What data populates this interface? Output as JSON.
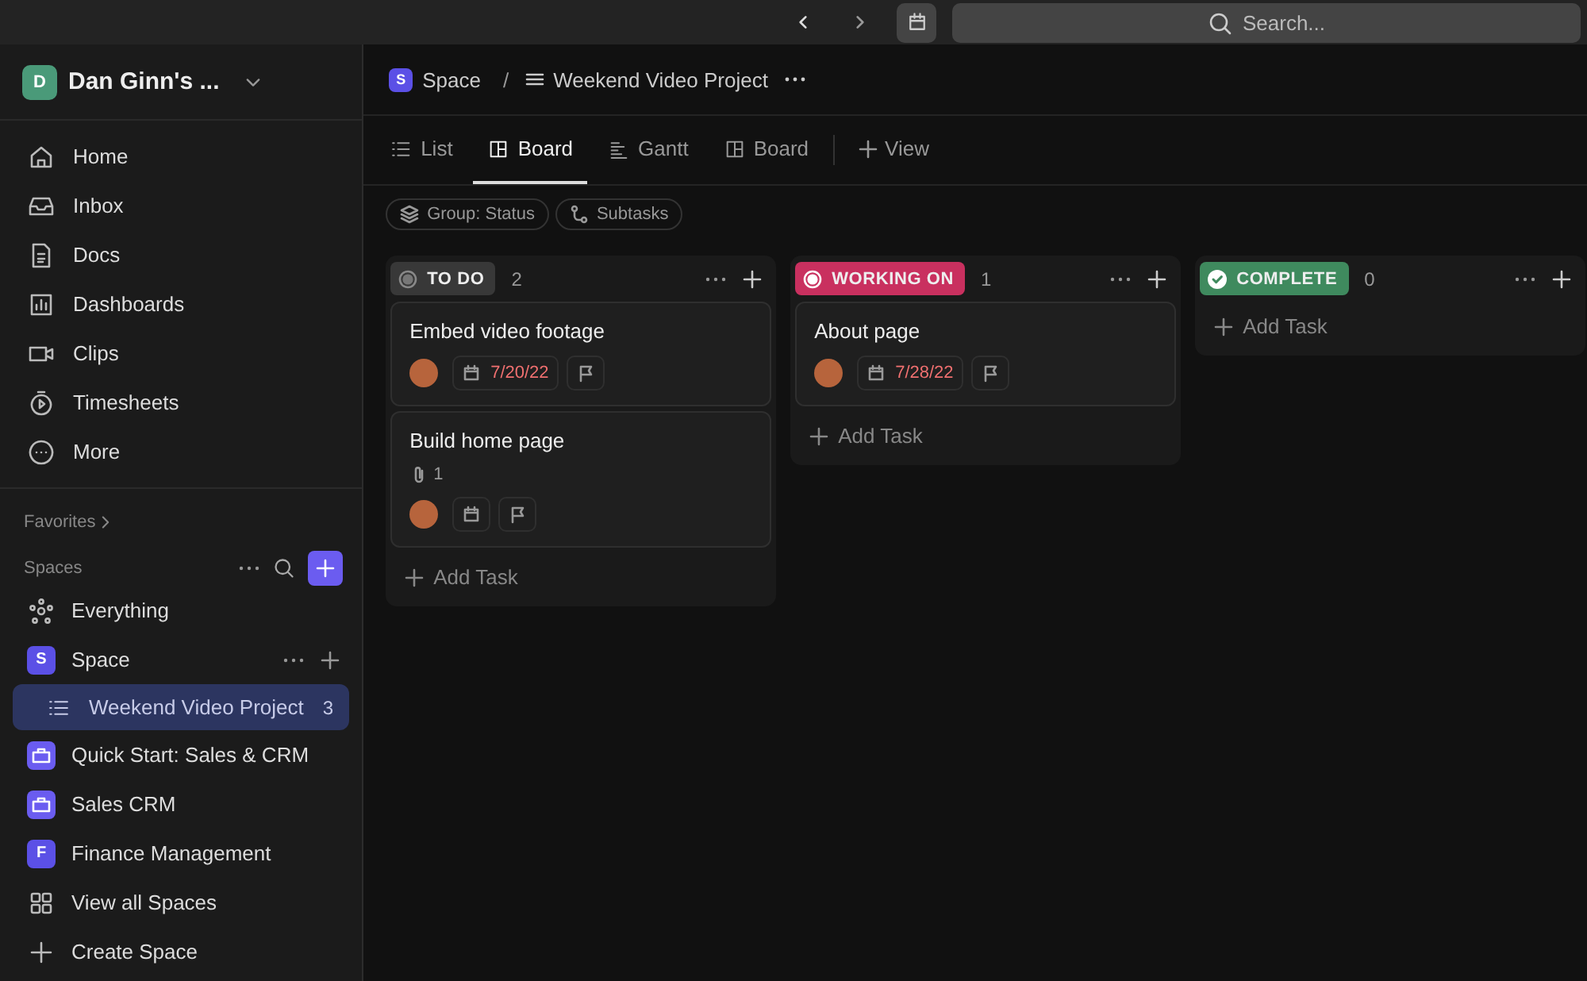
{
  "topbar": {
    "search": {
      "placeholder": "Search..."
    }
  },
  "sidebar": {
    "workspace": {
      "initial": "D",
      "name": "Dan Ginn's ..."
    },
    "nav": [
      {
        "kind": "home",
        "label": "Home",
        "selected": false
      },
      {
        "kind": "inbox",
        "label": "Inbox",
        "selected": false
      },
      {
        "kind": "docs",
        "label": "Docs",
        "selected": false
      },
      {
        "kind": "dashboards",
        "label": "Dashboards",
        "selected": false
      },
      {
        "kind": "clips",
        "label": "Clips",
        "selected": false
      },
      {
        "kind": "timesheets",
        "label": "Timesheets",
        "selected": false
      },
      {
        "kind": "more",
        "label": "More",
        "selected": false
      }
    ],
    "favorites": "Favorites",
    "spaces_label": "Spaces",
    "spaces": [
      {
        "kind": "everything",
        "label": "Everything",
        "selected": false
      },
      {
        "kind": "letter",
        "initial": "S",
        "label": "Space",
        "selected": false,
        "children": [
          {
            "label": "Weekend Video Project",
            "count": "3",
            "selected": true
          }
        ]
      },
      {
        "kind": "template",
        "label": "Quick Start: Sales & CRM",
        "selected": false
      },
      {
        "kind": "template",
        "label": "Sales CRM",
        "selected": false
      },
      {
        "kind": "letter",
        "initial": "F",
        "label": "Finance Management",
        "selected": false
      },
      {
        "kind": "grid",
        "label": "View all Spaces",
        "selected": false
      },
      {
        "kind": "plus",
        "label": "Create Space",
        "selected": false
      }
    ]
  },
  "breadcrumb": {
    "space_initial": "S",
    "space": "Space",
    "separator": "/",
    "list": "Weekend Video Project"
  },
  "views": [
    {
      "kind": "list",
      "label": "List",
      "selected": false
    },
    {
      "kind": "board",
      "label": "Board",
      "selected": true
    },
    {
      "kind": "gantt",
      "label": "Gantt",
      "selected": false
    },
    {
      "kind": "board",
      "label": "Board",
      "selected": false
    }
  ],
  "add_view": "View",
  "chips": [
    {
      "kind": "layers",
      "label": "Group: Status"
    },
    {
      "kind": "subtasks",
      "label": "Subtasks"
    }
  ],
  "columns": [
    {
      "kind": "todo",
      "status": "TO DO",
      "count": "2",
      "color": "#383838",
      "add_task": "Add Task",
      "tasks": [
        {
          "title": "Embed video footage",
          "due": "7/20/22",
          "overdue": true
        },
        {
          "title": "Build home page",
          "attachments": "1"
        }
      ]
    },
    {
      "kind": "working",
      "status": "WORKING ON",
      "count": "1",
      "color": "#c9305f",
      "add_task": "Add Task",
      "tasks": [
        {
          "title": "About page",
          "due": "7/28/22",
          "overdue": true
        }
      ]
    },
    {
      "kind": "complete",
      "status": "COMPLETE",
      "count": "0",
      "color": "#3f8a5e",
      "add_task": "Add Task"
    }
  ]
}
